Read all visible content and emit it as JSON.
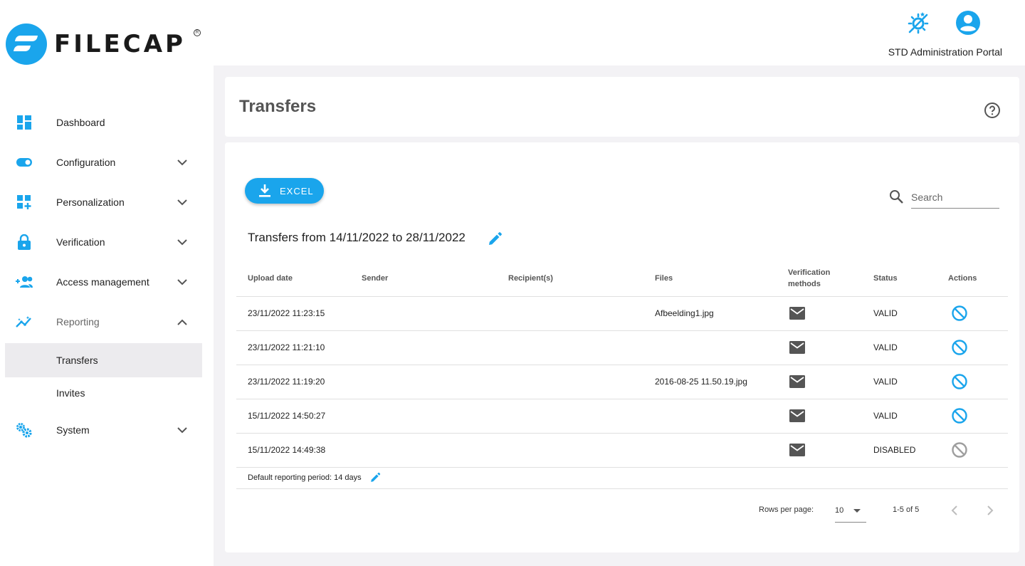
{
  "header": {
    "brand": "FILECAP",
    "portal_label": "STD Administration Portal",
    "icons": [
      "theme-toggle-icon",
      "account-circle-icon"
    ]
  },
  "sidebar": {
    "items": [
      {
        "label": "Dashboard",
        "icon": "dashboard-icon"
      },
      {
        "label": "Configuration",
        "icon": "toggle-icon",
        "expandable": true
      },
      {
        "label": "Personalization",
        "icon": "widgets-add-icon",
        "expandable": true
      },
      {
        "label": "Verification",
        "icon": "lock-icon",
        "expandable": true
      },
      {
        "label": "Access management",
        "icon": "group-add-icon",
        "expandable": true
      },
      {
        "label": "Reporting",
        "icon": "insights-icon",
        "expandable": true,
        "expanded": true
      },
      {
        "label": "Transfers",
        "sub": true,
        "active": true
      },
      {
        "label": "Invites",
        "sub": true
      },
      {
        "label": "System",
        "icon": "settings-cogs-icon",
        "expandable": true
      }
    ]
  },
  "page": {
    "title": "Transfers"
  },
  "toolbar": {
    "excel_label": "EXCEL",
    "search_placeholder": "Search"
  },
  "range_title": "Transfers from 14/11/2022 to 28/11/2022",
  "table": {
    "columns": [
      "Upload date",
      "Sender",
      "Recipient(s)",
      "Files",
      "Verification methods",
      "Status",
      "Actions"
    ],
    "rows": [
      {
        "upload_date": "23/11/2022 11:23:15",
        "sender": "",
        "recipients": "",
        "files": "Afbeelding1.jpg",
        "verification": "mail",
        "status": "VALID",
        "action": "block"
      },
      {
        "upload_date": "23/11/2022 11:21:10",
        "sender": "",
        "recipients": "",
        "files": "",
        "verification": "mail",
        "status": "VALID",
        "action": "block"
      },
      {
        "upload_date": "23/11/2022 11:19:20",
        "sender": "",
        "recipients": "",
        "files": "2016-08-25 11.50.19.jpg",
        "verification": "mail",
        "status": "VALID",
        "action": "block"
      },
      {
        "upload_date": "15/11/2022 14:50:27",
        "sender": "",
        "recipients": "",
        "files": "",
        "verification": "mail",
        "status": "VALID",
        "action": "block"
      },
      {
        "upload_date": "15/11/2022 14:49:38",
        "sender": "",
        "recipients": "",
        "files": "",
        "verification": "mail",
        "status": "DISABLED",
        "action": "block-disabled"
      }
    ]
  },
  "default_period": "Default reporting period: 14 days",
  "pagination": {
    "rows_per_page_label": "Rows per page:",
    "rows_per_page": "10",
    "range": "1-5 of 5"
  },
  "colors": {
    "accent": "#1aa5ec",
    "disabled": "#9e9e9e",
    "background": "#f3f2f5"
  }
}
